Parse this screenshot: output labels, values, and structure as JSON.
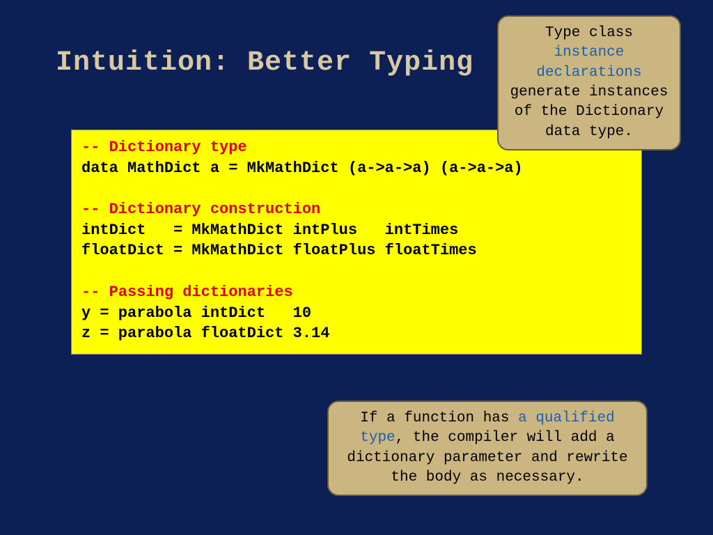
{
  "title": "Intuition: Better Typing",
  "code": {
    "c1": "-- Dictionary type",
    "l1": "data MathDict a = MkMathDict (a->a->a) (a->a->a)",
    "c2": "-- Dictionary construction",
    "l2": "intDict   = MkMathDict intPlus   intTimes",
    "l3": "floatDict = MkMathDict floatPlus floatTimes",
    "c3": "-- Passing dictionaries",
    "l4": "y = parabola intDict   10",
    "l5": "z = parabola floatDict 3.14"
  },
  "calloutTop": {
    "t1": "Type class ",
    "hl": "instance declarations",
    "t2": " generate instances of the Dictionary data type."
  },
  "calloutBottom": {
    "t1": "If a function has ",
    "hl": "a qualified type",
    "t2": ", the compiler will add a dictionary parameter and rewrite the body as necessary."
  }
}
